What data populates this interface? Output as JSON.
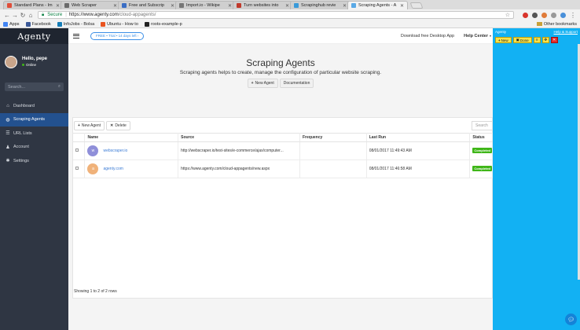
{
  "browser": {
    "tabs": [
      {
        "label": "Standard Plans - Im",
        "color": "#e04e3a",
        "active": false
      },
      {
        "label": "Web Scraper",
        "color": "#6b6b6b",
        "active": false
      },
      {
        "label": "Free and Subscrip",
        "color": "#3b6ec4",
        "active": false
      },
      {
        "label": "Import.io - Wikipe",
        "color": "#777777",
        "active": false
      },
      {
        "label": "Turn websites into",
        "color": "#c0392b",
        "active": false
      },
      {
        "label": "Scrapinghub revie",
        "color": "#3a9ad9",
        "active": false
      },
      {
        "label": "Scraping Agents - A",
        "color": "#5aa9e6",
        "active": true
      }
    ],
    "secure_label": "Secure",
    "url_host": "https://www.agenty.com",
    "url_path": "/cloud-appagents/",
    "bookmarks": [
      {
        "label": "Apps",
        "color": "#4285f4"
      },
      {
        "label": "Facebook",
        "color": "#3b5998"
      },
      {
        "label": "InfoJobs - Bolsa",
        "color": "#167db7"
      },
      {
        "label": "Ubuntu - How to",
        "color": "#e95420"
      },
      {
        "label": "roots-example-p",
        "color": "#222222"
      }
    ],
    "other_bookmarks": "Other bookmarks"
  },
  "sidebar": {
    "logo": "Agenty",
    "user_name": "Hello, pepe",
    "user_status": "Online",
    "search_placeholder": "Search...",
    "items": [
      {
        "label": "Dashboard",
        "icon": "home-icon",
        "glyph": "⌂",
        "active": false
      },
      {
        "label": "Scraping Agents",
        "icon": "globe-icon",
        "glyph": "◍",
        "active": true
      },
      {
        "label": "URL Lists",
        "icon": "list-icon",
        "glyph": "☰",
        "active": false
      },
      {
        "label": "Account",
        "icon": "user-icon",
        "glyph": "♟",
        "active": false
      },
      {
        "label": "Settings",
        "icon": "gear-icon",
        "glyph": "✱",
        "active": false
      }
    ]
  },
  "topbar": {
    "trial": "FREE • Trial • 14 days left ›",
    "download": "Download free Desktop App",
    "help": "Help Center"
  },
  "main": {
    "title": "Scraping Agents",
    "subtitle": "Scraping agents helps to create, manage the configuration of particular website scraping.",
    "new_agent": "New Agent",
    "documentation": "Documentation",
    "toolbar_new": "New Agent",
    "toolbar_delete": "Delete",
    "search_placeholder": "Search",
    "columns": [
      "",
      "Name",
      "Source",
      "Frequency",
      "Last Run",
      "Status"
    ],
    "rows": [
      {
        "initial": "w",
        "avatar_color": "#8f8fd9",
        "name": "webscraper.io",
        "source": "http://webscraper.io/test-sites/e-commerce/ajax/computer...",
        "frequency": "",
        "last_run": "08/01/2017 11:49:43 AM",
        "status": "Completed"
      },
      {
        "initial": "a",
        "avatar_color": "#f0b27a",
        "name": "agenty.com",
        "source": "https://www.agenty.com/cloud-appagents/new.aspx",
        "frequency": "",
        "last_run": "08/01/2017 11:46:58 AM",
        "status": "Completed"
      }
    ],
    "showing": "Showing 1 to 2 of 2 rows"
  },
  "extension": {
    "title": "Agenty",
    "help": "Help & Support",
    "new_label": "New",
    "done_label": "Done"
  }
}
